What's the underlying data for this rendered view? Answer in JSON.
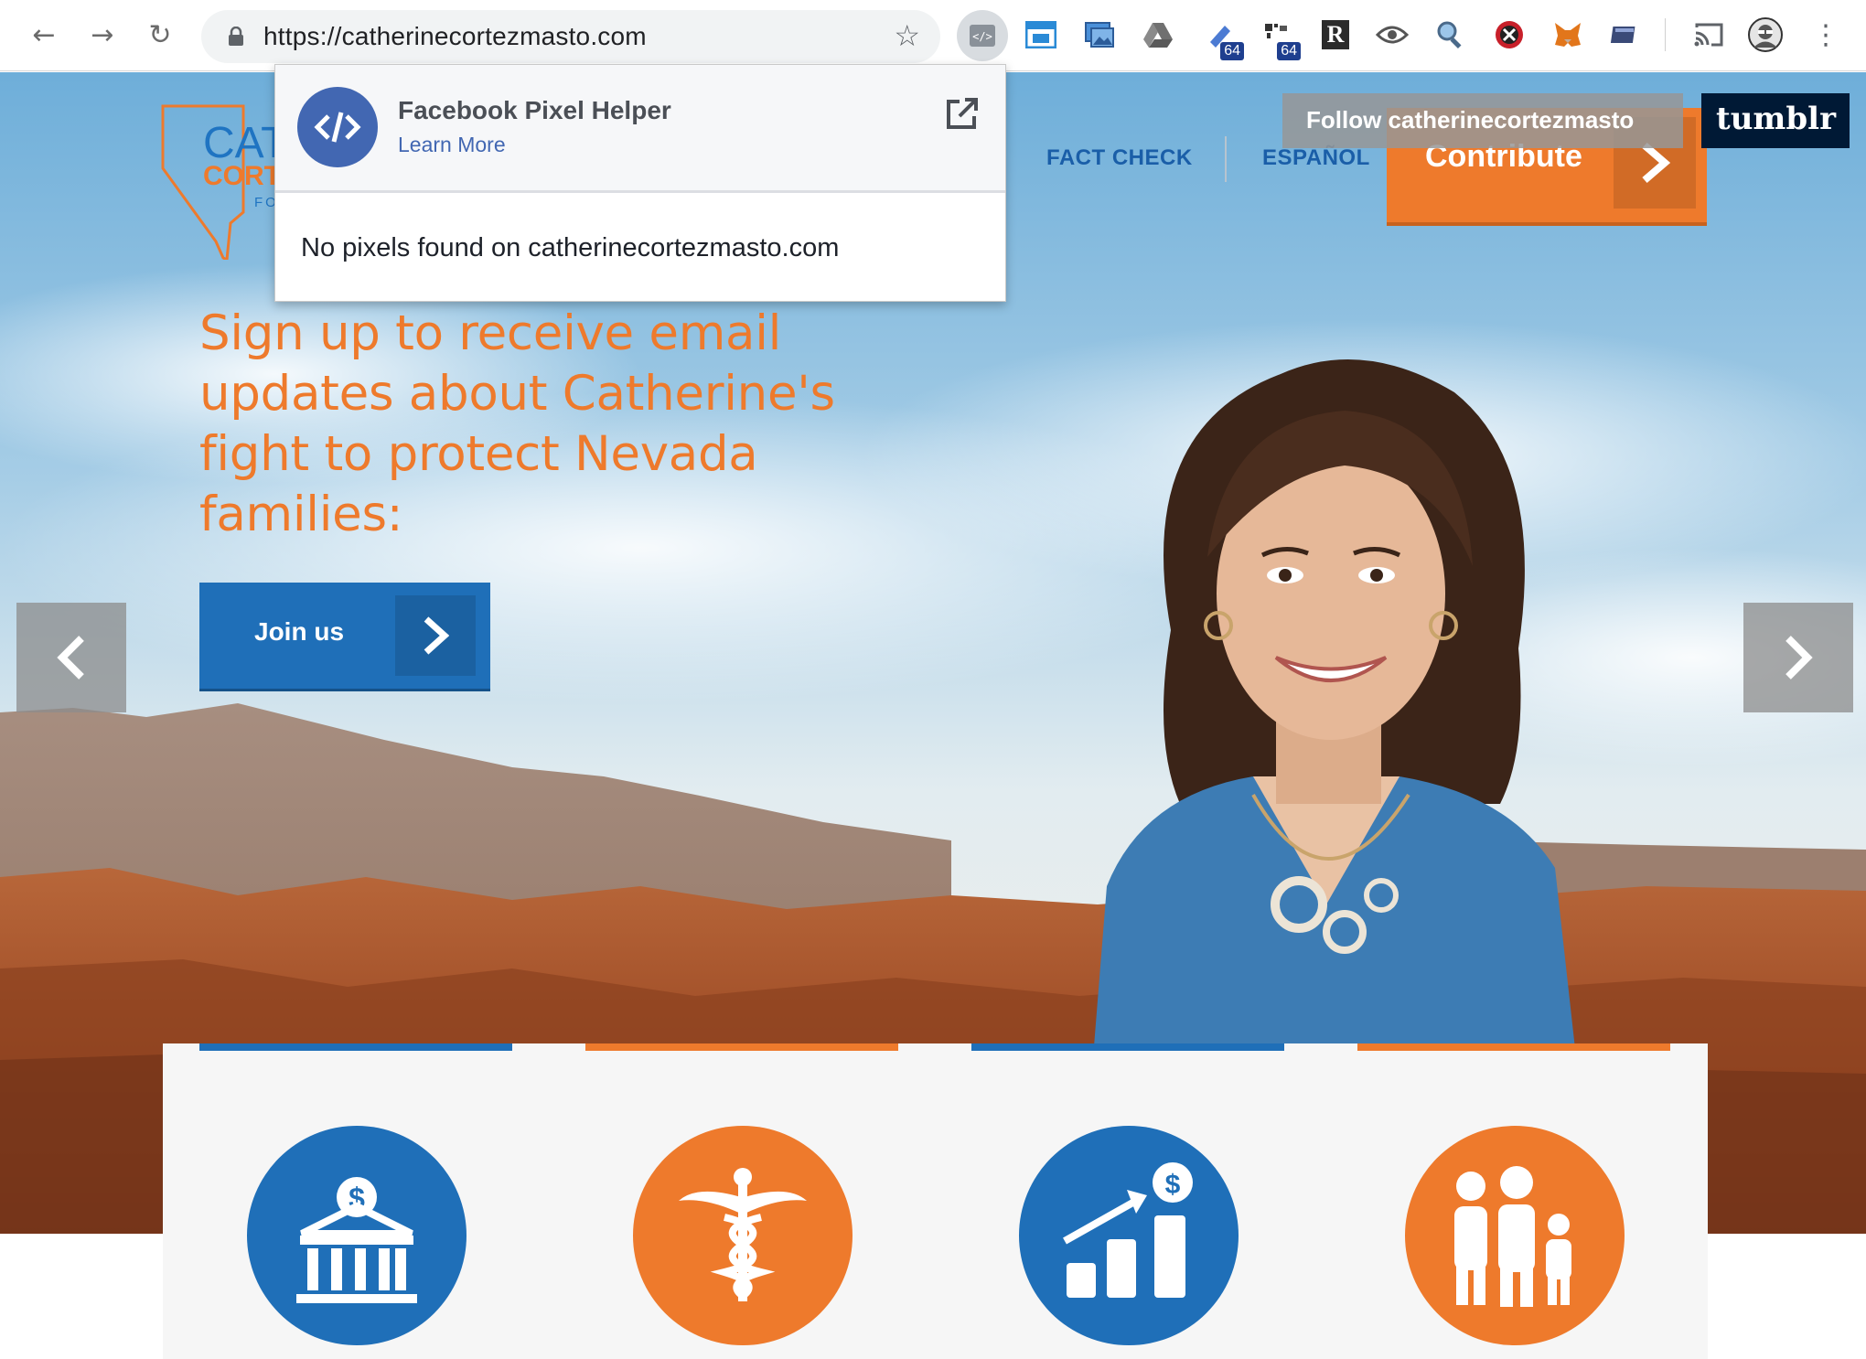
{
  "browser": {
    "url": "https://catherinecortezmasto.com",
    "back_icon": "←",
    "forward_icon": "→",
    "reload_icon": "↻",
    "star_icon": "☆",
    "extensions": [
      {
        "name": "facebook-pixel-helper"
      },
      {
        "name": "window-resizer"
      },
      {
        "name": "image-tool"
      },
      {
        "name": "google-drive"
      },
      {
        "name": "base64-a",
        "badge": "64"
      },
      {
        "name": "base64-b",
        "badge": "64"
      },
      {
        "name": "readability",
        "letter": "R"
      },
      {
        "name": "eye"
      },
      {
        "name": "magnifier"
      },
      {
        "name": "blocker"
      },
      {
        "name": "metamask"
      },
      {
        "name": "tab-manager"
      },
      {
        "name": "cast"
      },
      {
        "name": "profile-avatar"
      },
      {
        "name": "menu",
        "glyph": "⋮"
      }
    ]
  },
  "site": {
    "logo": {
      "line1": "CAT",
      "line2": "CORT",
      "line3": "FO"
    },
    "nav": {
      "fact_check": "FACT CHECK",
      "espanol": "ESPAÑOL"
    },
    "contribute_label": "Contribute",
    "tumblr": {
      "follow_text": "Follow catherinecortezmasto",
      "brand": "tumblr"
    },
    "hero": {
      "heading": "Sign up to receive email updates about Catherine's fight to protect Nevada families:",
      "join_label": "Join us"
    },
    "carousel": {
      "prev": "❮",
      "next": "❯"
    },
    "issues": [
      {
        "icon": "bank-dollar-icon",
        "color": "#1f6fb8"
      },
      {
        "icon": "caduceus-icon",
        "color": "#ee7a2c"
      },
      {
        "icon": "growth-chart-icon",
        "color": "#1f6fb8"
      },
      {
        "icon": "family-icon",
        "color": "#ee7a2c"
      }
    ],
    "colors": {
      "brand_blue": "#1f6fb8",
      "brand_orange": "#ee7a2c",
      "tumblr_navy": "#001935"
    }
  },
  "popup": {
    "title": "Facebook Pixel Helper",
    "learn_more": "Learn More",
    "message": "No pixels found on catherinecortezmasto.com"
  }
}
